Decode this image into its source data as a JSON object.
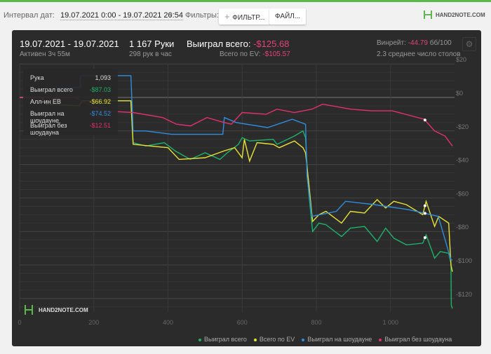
{
  "toolbar": {
    "interval_label": "Интервал дат:",
    "interval_value": "19.07.2021 0:00 - 19.07.2021 20:54",
    "filters_label": "Фильтры:",
    "filter_button": "ФИЛЬТР...",
    "file_button": "ФАЙЛ...",
    "logo": "HAND2NOTE.COM"
  },
  "summary": {
    "date_range": "19.07.2021 - 19.07.2021",
    "active": "Активен 3ч 55м",
    "hands": "1 167 Руки",
    "hands_per_hour": "298 рук в час",
    "won_label": "Выиграл всего:",
    "won_value": "-$125.68",
    "ev_label": "Всего по EV:",
    "ev_value": "-$105.57",
    "winrate_label": "Винрейт:",
    "winrate_value": "-44.79",
    "winrate_unit": "бб/100",
    "tables": "2.3 среднее число столов"
  },
  "tooltip": {
    "rows": [
      {
        "label": "Рука",
        "value": "1,093"
      },
      {
        "label": "Выиграл всего",
        "value": "-$87.03"
      },
      {
        "label": "Алл-ин ЕВ",
        "value": "-$66.92"
      },
      {
        "label": "Выиграл на шоудауне",
        "value": "-$74.52"
      },
      {
        "label": "Выиграл без шоудауна",
        "value": "-$12.51"
      }
    ]
  },
  "watermark": "HAND2NOTE.COM",
  "chart_data": {
    "type": "line",
    "xlim": [
      0,
      1167
    ],
    "ylim": [
      -128,
      22
    ],
    "x_ticks": [
      {
        "v": 0,
        "label": "0"
      },
      {
        "v": 200,
        "label": "200"
      },
      {
        "v": 400,
        "label": "400"
      },
      {
        "v": 600,
        "label": "600"
      },
      {
        "v": 800,
        "label": "800"
      },
      {
        "v": 1000,
        "label": "1 000"
      }
    ],
    "y_ticks": [
      {
        "v": 20,
        "label": "$20"
      },
      {
        "v": 0,
        "label": "$0"
      },
      {
        "v": -20,
        "label": "-$20"
      },
      {
        "v": -40,
        "label": "-$40"
      },
      {
        "v": -60,
        "label": "-$60"
      },
      {
        "v": -80,
        "label": "-$80"
      },
      {
        "v": -100,
        "label": "-$100"
      },
      {
        "v": -120,
        "label": "-$120"
      }
    ],
    "hover_x": 1093,
    "series": [
      {
        "name": "Выиграл всего",
        "color": "#1db36a",
        "points": [
          [
            0,
            0
          ],
          [
            60,
            0
          ],
          [
            70,
            -4
          ],
          [
            160,
            -5
          ],
          [
            170,
            -2
          ],
          [
            300,
            -2
          ],
          [
            306,
            -27
          ],
          [
            340,
            -29
          ],
          [
            390,
            -27
          ],
          [
            420,
            -32
          ],
          [
            460,
            -37
          ],
          [
            500,
            -33
          ],
          [
            540,
            -37
          ],
          [
            560,
            -33
          ],
          [
            590,
            -28
          ],
          [
            600,
            -24
          ],
          [
            620,
            -26
          ],
          [
            684,
            -25
          ],
          [
            694,
            -28
          ],
          [
            741,
            -23
          ],
          [
            764,
            -20
          ],
          [
            771,
            -24
          ],
          [
            779,
            -56
          ],
          [
            790,
            -80
          ],
          [
            807,
            -75
          ],
          [
            826,
            -76
          ],
          [
            868,
            -83
          ],
          [
            892,
            -78
          ],
          [
            930,
            -77
          ],
          [
            964,
            -86
          ],
          [
            987,
            -78
          ],
          [
            1009,
            -84
          ],
          [
            1043,
            -88
          ],
          [
            1087,
            -87
          ],
          [
            1096,
            -82
          ],
          [
            1119,
            -96
          ],
          [
            1134,
            -92
          ],
          [
            1157,
            -93
          ],
          [
            1163,
            -99
          ],
          [
            1164,
            -124
          ],
          [
            1167,
            -126
          ]
        ]
      },
      {
        "name": "Всего по EV",
        "color": "#e8e234",
        "points": [
          [
            0,
            0
          ],
          [
            60,
            0
          ],
          [
            70,
            -4
          ],
          [
            160,
            -5
          ],
          [
            170,
            -2
          ],
          [
            300,
            -2
          ],
          [
            306,
            -28
          ],
          [
            400,
            -30
          ],
          [
            430,
            -37
          ],
          [
            500,
            -36
          ],
          [
            550,
            -32
          ],
          [
            580,
            -30
          ],
          [
            600,
            -36
          ],
          [
            606,
            -25
          ],
          [
            620,
            -38
          ],
          [
            640,
            -27
          ],
          [
            684,
            -28
          ],
          [
            700,
            -30
          ],
          [
            741,
            -26
          ],
          [
            764,
            -30
          ],
          [
            771,
            -33
          ],
          [
            779,
            -50
          ],
          [
            790,
            -74
          ],
          [
            807,
            -70
          ],
          [
            826,
            -68
          ],
          [
            868,
            -75
          ],
          [
            892,
            -68
          ],
          [
            930,
            -69
          ],
          [
            964,
            -61
          ],
          [
            987,
            -66
          ],
          [
            1009,
            -62
          ],
          [
            1043,
            -64
          ],
          [
            1087,
            -70
          ],
          [
            1096,
            -62
          ],
          [
            1119,
            -77
          ],
          [
            1130,
            -71
          ],
          [
            1157,
            -75
          ],
          [
            1163,
            -100
          ],
          [
            1167,
            -104
          ]
        ]
      },
      {
        "name": "Выиграл на шоудауне",
        "color": "#2f8ee0",
        "points": [
          [
            0,
            0
          ],
          [
            100,
            0
          ],
          [
            100,
            6
          ],
          [
            164,
            6
          ],
          [
            164,
            13
          ],
          [
            300,
            13
          ],
          [
            306,
            -20
          ],
          [
            340,
            -20
          ],
          [
            410,
            -22
          ],
          [
            548,
            -22
          ],
          [
            552,
            -12
          ],
          [
            584,
            -15
          ],
          [
            669,
            -18
          ],
          [
            735,
            -13
          ],
          [
            771,
            -16
          ],
          [
            775,
            -47
          ],
          [
            788,
            -71
          ],
          [
            854,
            -68
          ],
          [
            879,
            -62
          ],
          [
            958,
            -64
          ],
          [
            1049,
            -67
          ],
          [
            1129,
            -71
          ],
          [
            1163,
            -97
          ],
          [
            1167,
            -97
          ]
        ]
      },
      {
        "name": "Выиграл без шоудауна",
        "color": "#e3306f",
        "points": [
          [
            0,
            0
          ],
          [
            150,
            0
          ],
          [
            220,
            -8
          ],
          [
            306,
            -9
          ],
          [
            386,
            -12
          ],
          [
            423,
            -16
          ],
          [
            461,
            -17
          ],
          [
            505,
            -12
          ],
          [
            552,
            -15
          ],
          [
            571,
            -16
          ],
          [
            600,
            -9
          ],
          [
            665,
            -10
          ],
          [
            694,
            -7
          ],
          [
            741,
            -9
          ],
          [
            788,
            -7
          ],
          [
            817,
            -4
          ],
          [
            892,
            -7
          ],
          [
            949,
            -8
          ],
          [
            1005,
            -8
          ],
          [
            1091,
            -13
          ],
          [
            1119,
            -20
          ],
          [
            1147,
            -23
          ],
          [
            1167,
            -29
          ]
        ]
      }
    ]
  }
}
